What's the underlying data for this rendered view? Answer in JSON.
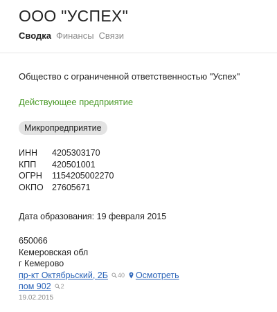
{
  "company": {
    "short_name": "ООО \"УСПЕХ\"",
    "full_name": "Общество с ограниченной ответственностью \"Успех\"",
    "status": "Действующее предприятие",
    "size_category": "Микропредприятие"
  },
  "tabs": [
    {
      "label": "Сводка",
      "active": true
    },
    {
      "label": "Финансы",
      "active": false
    },
    {
      "label": "Связи",
      "active": false
    }
  ],
  "codes": [
    {
      "label": "ИНН",
      "value": "4205303170"
    },
    {
      "label": "КПП",
      "value": "420501001"
    },
    {
      "label": "ОГРН",
      "value": "1154205002270"
    },
    {
      "label": "ОКПО",
      "value": "27605671"
    }
  ],
  "founded": {
    "label": "Дата образования:",
    "date": "19 февраля 2015"
  },
  "address": {
    "postal_code": "650066",
    "region": "Кемеровская обл",
    "city": "г Кемерово",
    "street": "пр-кт Октябрьский, 2Б",
    "street_count": "40",
    "map_link": "Осмотреть",
    "premises": "пом 902",
    "premises_count": "2",
    "date": "19.02.2015"
  },
  "colors": {
    "status_green": "#4a9a28",
    "link_blue": "#2a63b8",
    "badge_gray": "#e3e3e3"
  },
  "icons": {
    "search": "search-icon",
    "map_pin": "map-pin-icon"
  }
}
